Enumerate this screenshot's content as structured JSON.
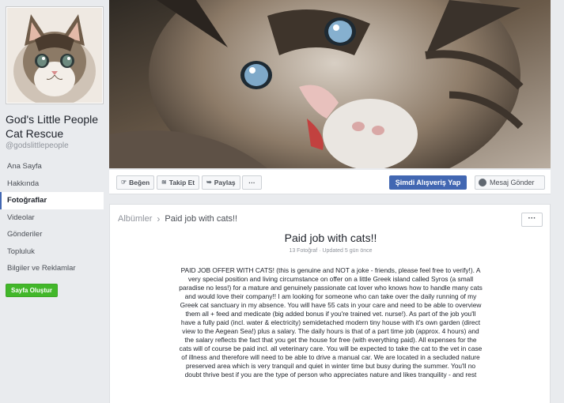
{
  "sidebar": {
    "page_name": "God's Little People Cat Rescue",
    "handle": "@godslittlepeople",
    "nav": [
      {
        "label": "Ana Sayfa",
        "active": false
      },
      {
        "label": "Hakkında",
        "active": false
      },
      {
        "label": "Fotoğraflar",
        "active": true
      },
      {
        "label": "Videolar",
        "active": false
      },
      {
        "label": "Gönderiler",
        "active": false
      },
      {
        "label": "Topluluk",
        "active": false
      },
      {
        "label": "Bilgiler ve Reklamlar",
        "active": false
      }
    ],
    "create_page_label": "Sayfa Oluştur"
  },
  "actions": {
    "like": "Beğen",
    "follow": "Takip Et",
    "share": "Paylaş",
    "more": "···",
    "shop": "Şimdi Alışveriş Yap",
    "message": "Mesaj Gönder"
  },
  "album": {
    "breadcrumb_root": "Albümler",
    "breadcrumb_sep": "›",
    "breadcrumb_current": "Paid job with cats!!",
    "more": "···",
    "title": "Paid job with cats!!",
    "meta": "13 Fotoğraf · Updated 5 gün önce",
    "description": "PAID JOB OFFER WITH CATS! (this is genuine and NOT a joke - friends, please feel free to verify!). A very special position and living circumstance on offer on a little Greek island called Syros (a small paradise no less!) for a mature and genuinely passionate cat lover who knows how to handle many cats and would love their company!! I am looking for someone who can take over the daily running of my Greek cat sanctuary in my absence. You will have 55 cats in your care and need to be able to overview them all + feed and medicate (big added bonus if you're trained vet. nurse!). As part of the job you'll have a fully paid (incl. water & electricity) semidetached modern tiny house with it's own garden (direct view to the Aegean Sea!) plus a salary. The daily hours is that of a part time job (approx. 4 hours) and the salary reflects the fact that you get the house for free (with everything paid). All expenses for the cats will of course be paid incl. all veterinary care. You will be expected to take the cat to the vet in case of illness and therefore will need to be able to drive a manual car. We are located in a secluded nature preserved area which is very tranquil and quiet in winter time but busy during the summer. You'll no doubt thrive best if you are the type of person who appreciates nature and likes tranquility - and rest"
  },
  "colors": {
    "brand_blue": "#4267b2",
    "create_green": "#42b72a",
    "background": "#e9ebee"
  },
  "icons": {
    "like": "thumbs-up-icon",
    "follow": "rss-icon",
    "share": "share-arrow-icon",
    "message": "messenger-icon"
  }
}
